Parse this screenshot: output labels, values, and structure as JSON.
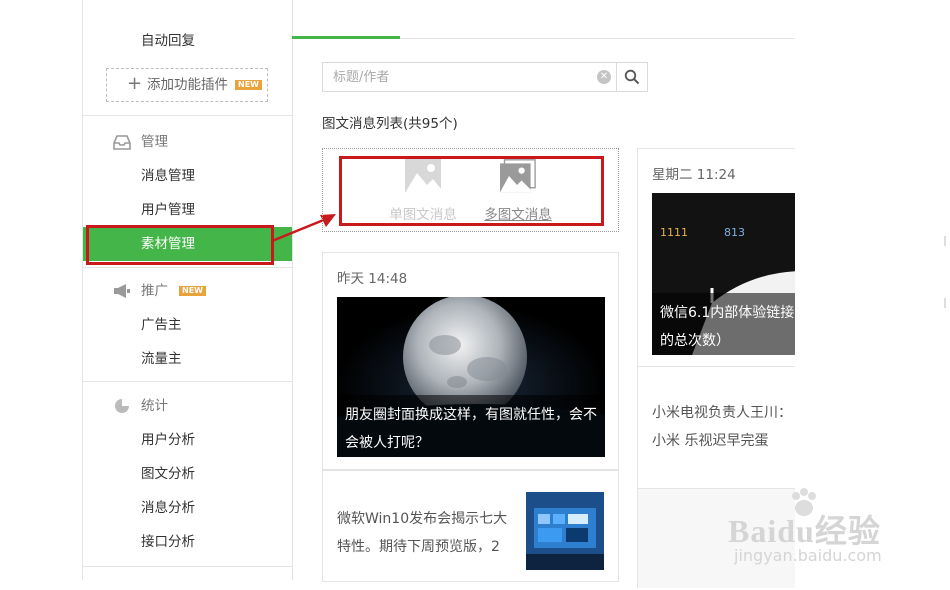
{
  "sidebar": {
    "auto_reply": "自动回复",
    "add_plugin": "添加功能插件",
    "new_badge": "NEW",
    "manage": {
      "heading": "管理",
      "items": [
        "消息管理",
        "用户管理",
        "素材管理"
      ]
    },
    "promote": {
      "heading": "推广",
      "items": [
        "广告主",
        "流量主"
      ]
    },
    "stats": {
      "heading": "统计",
      "items": [
        "用户分析",
        "图文分析",
        "消息分析",
        "接口分析"
      ]
    },
    "active_item": "素材管理"
  },
  "search": {
    "placeholder": "标题/作者"
  },
  "list_title": "图文消息列表(共95个)",
  "create": {
    "single": "单图文消息",
    "multi": "多图文消息"
  },
  "cards": [
    {
      "time": "昨天 14:48",
      "caption": "朋友圈封面换成这样，有图就任性，会不会被人打呢？",
      "sub_title": "微软Win10发布会揭示七大特性。期待下周预览版，2"
    },
    {
      "time": "星期二 11:24",
      "caption": "微信6.1内部体验链接别人的总次数）",
      "mini_numbers": [
        "1111",
        "813"
      ],
      "sub_title": "小米电视负责人王川：小米 乐视迟早完蛋"
    }
  ],
  "watermark": {
    "logo": "Baidu经验",
    "url": "jingyan.baidu.com"
  },
  "colors": {
    "accent_green": "#44b549",
    "annotation_red": "#c9191b"
  }
}
